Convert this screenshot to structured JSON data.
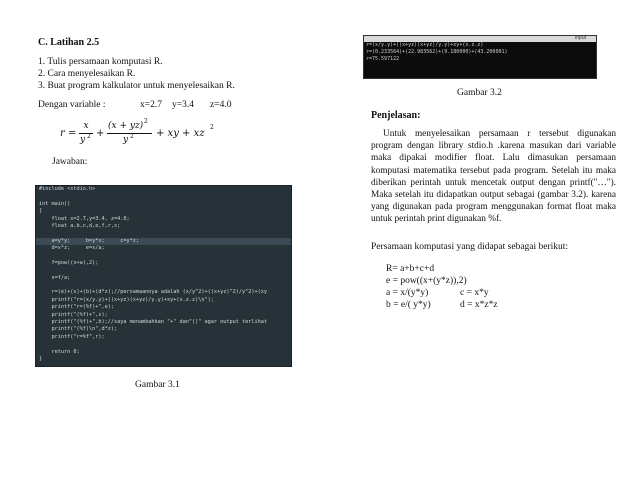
{
  "left": {
    "heading": "C. Latihan 2.5",
    "list": [
      "1.  Tulis persamaan komputasi R.",
      "2.  Cara menyelesaikan R.",
      "3.  Buat program kalkulator untuk menyelesaikan R."
    ],
    "variables": {
      "label": "Dengan variable :",
      "x": "x=2.7",
      "y": "y=3.4",
      "z": "z=4.0"
    },
    "formula": {
      "lhs": "r =",
      "frac1_num": "x",
      "frac1_den": "y",
      "exp2": "2",
      "plus": "+",
      "frac2_num": "(x + yz)",
      "frac2_den": "y",
      "tail": "+ xy + xz"
    },
    "answer_label": "Jawaban:",
    "code_lines": [
      "#include <stdio.h>",
      "",
      "int main()",
      "{",
      "    float x=2.7,y=3.4, z=4.0;",
      "    float a,b,c,d,e,f,r,s;",
      "",
      "    a=y*y;     b=y*x;     c=y*z;",
      "    d=x*z;     e=x/a;",
      "",
      "    f=pow((x+a),2);",
      "",
      "    s=f/a;",
      "",
      "    r=(e)+(s)+(b)+(d*z);//persamaannya adalah (x/y^2)+((x+yz)^2)/y^2)+(xy",
      "    printf(\"r=(x/y.y)+((x+yz)(x+yz)/y.y)+xy+(x.z.z)\\n\");",
      "    printf(\"r=(%f)+\",e);",
      "    printf(\"(%f)+\",s);",
      "    printf(\"(%f)+\",b);//saya menambahkan \"+\" dan\"()\" agar output terlihat",
      "    printf(\"(%f)\\n\",d*z);",
      "    printf(\"r=%f\",r);",
      "",
      "    return 0;",
      "}"
    ],
    "caption": "Gambar 3.1"
  },
  "right": {
    "console_title": "Input",
    "console_lines": [
      "r=(x/y.y)+((x+yz)(x+yz)/y.y)+xy+(x.z.z)",
      "r=(0.233564)+(22.983562)+(9.180000)+(43.200001)",
      "r=75.597122"
    ],
    "caption": "Gambar 3.2",
    "heading": "Penjelasan:",
    "paragraph": "Untuk menyelesaikan persamaan r tersebut digunakan program dengan library stdio.h .karena masukan dari variable maka dipakai modifier float. Lalu dimasukan persamaan komputasi matematika tersebut pada program. Setelah itu maka diberikan perintah untuk mencetak output dengan printf(\"…\"). Maka setelah itu didapatkan output sebagai (gambar 3.2). karena yang digunakan pada program menggunakan format float maka untuk perintah print digunakan %f.",
    "computation_intro": "Persamaan komputasi yang didapat sebagai berikut:",
    "eq1": "R= a+b+c+d",
    "eq2": "e = pow((x+(y*z)),2)",
    "eq3a": "a = x/(y*y)",
    "eq3b": "c = x*y",
    "eq4a": "b = e/( y*y)",
    "eq4b": "d = x*z*z"
  }
}
